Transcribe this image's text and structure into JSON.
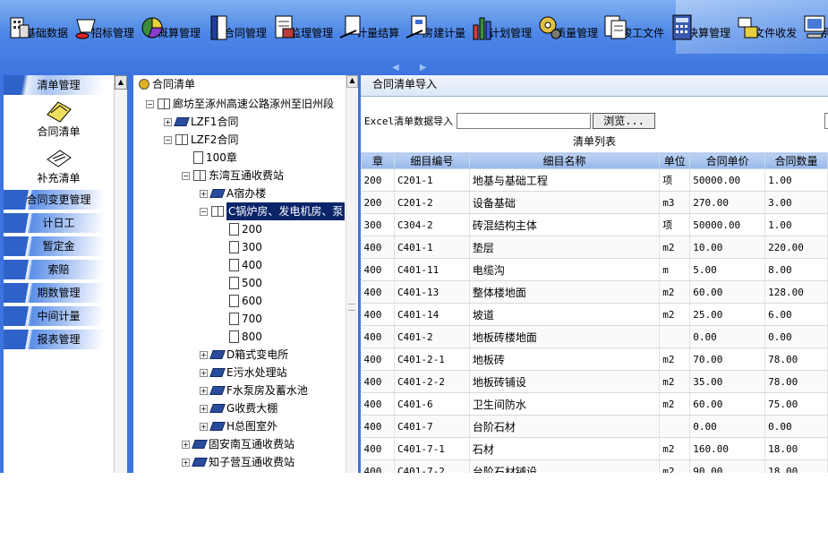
{
  "toolbar": {
    "items": [
      {
        "label": "基础数据",
        "icon": "building-data-icon"
      },
      {
        "label": "招标管理",
        "icon": "bidding-gavel-icon"
      },
      {
        "label": "概算管理",
        "icon": "pie-chart-icon"
      },
      {
        "label": "合同管理",
        "icon": "binder-contract-icon"
      },
      {
        "label": "监理管理",
        "icon": "document-inspect-icon"
      },
      {
        "label": "计量结算",
        "icon": "measure-settle-icon"
      },
      {
        "label": "房建计量",
        "icon": "house-measure-icon"
      },
      {
        "label": "计划管理",
        "icon": "bar-chart-icon"
      },
      {
        "label": "质量管理",
        "icon": "gear-quality-icon"
      },
      {
        "label": "竣工文件",
        "icon": "completion-docs-icon"
      },
      {
        "label": "决算管理",
        "icon": "calculator-icon"
      },
      {
        "label": "文件收发",
        "icon": "file-exchange-icon"
      },
      {
        "label": "系统管理",
        "icon": "computer-monitor-icon"
      }
    ]
  },
  "leftnav": {
    "top_label": "清单管理",
    "icon_items": [
      {
        "label": "合同清单",
        "icon": "contract-list-icon"
      },
      {
        "label": "补充清单",
        "icon": "supplement-list-icon"
      }
    ],
    "items": [
      "合同变更管理",
      "计日工",
      "暂定金",
      "索赔",
      "期数管理",
      "中间计量",
      "报表管理"
    ]
  },
  "tree": {
    "root_label": "合同清单",
    "nodes": [
      {
        "label": "廊坊至涿州高速公路涿州至旧州段",
        "exp": "-"
      },
      {
        "label": "LZF1合同",
        "exp": "+"
      },
      {
        "label": "LZF2合同",
        "exp": "-"
      },
      {
        "label": "100章",
        "exp": ""
      },
      {
        "label": "东湾互通收费站",
        "exp": "-"
      },
      {
        "label": "A宿办楼",
        "exp": "+"
      },
      {
        "label": "C锅炉房、发电机房、泵",
        "exp": "-"
      },
      {
        "label": "200",
        "exp": ""
      },
      {
        "label": "300",
        "exp": ""
      },
      {
        "label": "400",
        "exp": ""
      },
      {
        "label": "500",
        "exp": ""
      },
      {
        "label": "600",
        "exp": ""
      },
      {
        "label": "700",
        "exp": ""
      },
      {
        "label": "800",
        "exp": ""
      },
      {
        "label": "D箱式变电所",
        "exp": "+"
      },
      {
        "label": "E污水处理站",
        "exp": "+"
      },
      {
        "label": "F水泵房及蓄水池",
        "exp": "+"
      },
      {
        "label": "G收费大棚",
        "exp": "+"
      },
      {
        "label": "H总图室外",
        "exp": "+"
      },
      {
        "label": "固安南互通收费站",
        "exp": "+"
      },
      {
        "label": "知子营互通收费站",
        "exp": "+"
      }
    ]
  },
  "main": {
    "title": "合同清单导入",
    "import_label": "Excel清单数据导入",
    "file_value": "",
    "browse_label": "浏览...",
    "list_title": "清单列表",
    "columns": [
      "章",
      "细目编号",
      "细目名称",
      "单位",
      "合同单价",
      "合同数量"
    ],
    "rows": [
      [
        "200",
        "C201-1",
        "地基与基础工程",
        "项",
        "50000.00",
        "1.00"
      ],
      [
        "200",
        "C201-2",
        "设备基础",
        "m3",
        "270.00",
        "3.00"
      ],
      [
        "300",
        "C304-2",
        "砖混结构主体",
        "项",
        "50000.00",
        "1.00"
      ],
      [
        "400",
        "C401-1",
        "垫层",
        "m2",
        "10.00",
        "220.00"
      ],
      [
        "400",
        "C401-11",
        "电缆沟",
        "m",
        "5.00",
        "8.00"
      ],
      [
        "400",
        "C401-13",
        "整体楼地面",
        "m2",
        "60.00",
        "128.00"
      ],
      [
        "400",
        "C401-14",
        "坡道",
        "m2",
        "25.00",
        "6.00"
      ],
      [
        "400",
        "C401-2",
        "地板砖楼地面",
        "",
        "0.00",
        "0.00"
      ],
      [
        "400",
        "C401-2-1",
        "地板砖",
        "m2",
        "70.00",
        "78.00"
      ],
      [
        "400",
        "C401-2-2",
        "地板砖铺设",
        "m2",
        "35.00",
        "78.00"
      ],
      [
        "400",
        "C401-6",
        "卫生间防水",
        "m2",
        "60.00",
        "75.00"
      ],
      [
        "400",
        "C401-7",
        "台阶石材",
        "",
        "0.00",
        "0.00"
      ],
      [
        "400",
        "C401-7-1",
        "石材",
        "m2",
        "160.00",
        "18.00"
      ],
      [
        "400",
        "C401-7-2",
        "台阶石材铺设",
        "m2",
        "90.00",
        "18.00"
      ]
    ]
  }
}
